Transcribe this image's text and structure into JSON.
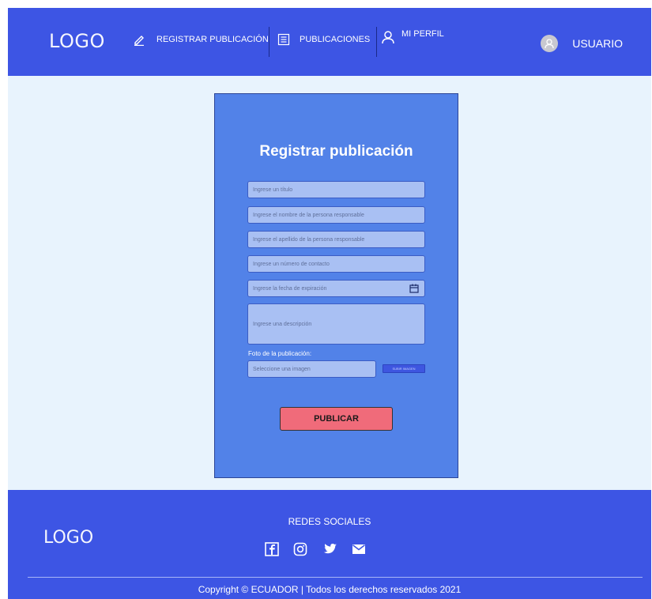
{
  "header": {
    "logo": "LOGO",
    "nav": [
      {
        "label": "REGISTRAR PUBLICACIÓN",
        "icon": "pencil-icon"
      },
      {
        "label": "PUBLICACIONES",
        "icon": "list-icon"
      },
      {
        "label": "MI PERFIL",
        "icon": "user-icon"
      }
    ],
    "user_label": "USUARIO"
  },
  "form": {
    "title": "Registrar publicación",
    "placeholders": {
      "title": "Ingrese un título",
      "first_name": "Ingrese el nombre de la persona responsable",
      "last_name": "Ingrese el apellido de la persona responsable",
      "contact": "Ingrese un número de contacto",
      "expiry": "Ingrese la fecha de expiración",
      "description": "Ingrese una descripción",
      "image": "Seleccione una imagen"
    },
    "photo_label": "Foto de la publicación:",
    "upload_label": "SUBIR IMAGEN",
    "publish_label": "PUBLICAR"
  },
  "footer": {
    "logo": "LOGO",
    "social_title": "REDES SOCIALES",
    "copyright": "Copyright © ECUADOR  |  Todos los derechos reservados 2021"
  },
  "colors": {
    "header_bg": "#3d55e4",
    "card_bg": "#5282e8",
    "field_bg": "#a9c0f3",
    "publish_bg": "#f06b7a",
    "page_bg": "#e8f3fd"
  }
}
